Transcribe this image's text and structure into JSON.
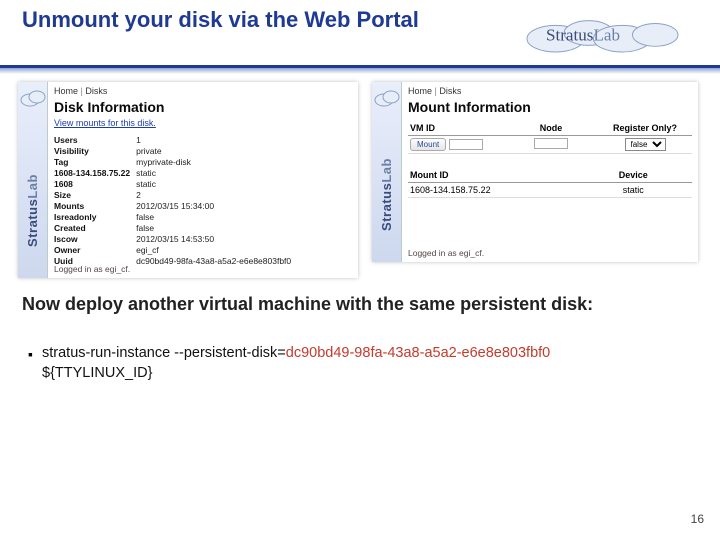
{
  "slide": {
    "title": "Unmount your disk via the Web Portal",
    "subtitle": "Now deploy another virtual machine with the same persistent disk:",
    "command_prefix": "stratus-run-instance  --persistent-disk=",
    "command_uuid": "dc90bd49-98fa-43a8-a5a2-e6e8e803fbf0",
    "command_suffix": "   ${TTYLINUX_ID}",
    "page_number": "16",
    "brand": "Stratus",
    "brand_suffix": "Lab",
    "vbrand": "Stratus",
    "vbrand_suffix": "Lab"
  },
  "left_panel": {
    "crumb1": "Home",
    "crumb2": "Disks",
    "heading": "Disk Information",
    "view_link": "View mounts for this disk.",
    "rows": [
      {
        "k": "Users",
        "v": "1"
      },
      {
        "k": "Visibility",
        "v": "private"
      },
      {
        "k": "Tag",
        "v": "myprivate-disk"
      },
      {
        "k": "1608-134.158.75.22",
        "v": "static"
      },
      {
        "k": "1608",
        "v": "static"
      },
      {
        "k": "Size",
        "v": "2"
      },
      {
        "k": "Mounts",
        "v": "2012/03/15 15:34:00"
      },
      {
        "k": "Isreadonly",
        "v": "false"
      },
      {
        "k": "Created",
        "v": "false"
      },
      {
        "k": "Iscow",
        "v": "2012/03/15 14:53:50"
      },
      {
        "k": "Owner",
        "v": "egi_cf"
      },
      {
        "k": "Uuid",
        "v": "dc90bd49-98fa-43a8-a5a2-e6e8e803fbf0"
      }
    ],
    "logged_in": "Logged in as egi_cf."
  },
  "right_panel": {
    "crumb1": "Home",
    "crumb2": "Disks",
    "heading": "Mount Information",
    "cols": {
      "c1": "VM ID",
      "c2": "Node",
      "c3": "Register Only?"
    },
    "mount_btn": "Mount",
    "vm_id_value": "",
    "node_value": "",
    "register_only_value": "false",
    "sub_cols": {
      "c1": "Mount ID",
      "c2": "Device"
    },
    "sub_row": {
      "c1": "1608-134.158.75.22",
      "c2": "static"
    },
    "logged_in": "Logged in as egi_cf."
  }
}
